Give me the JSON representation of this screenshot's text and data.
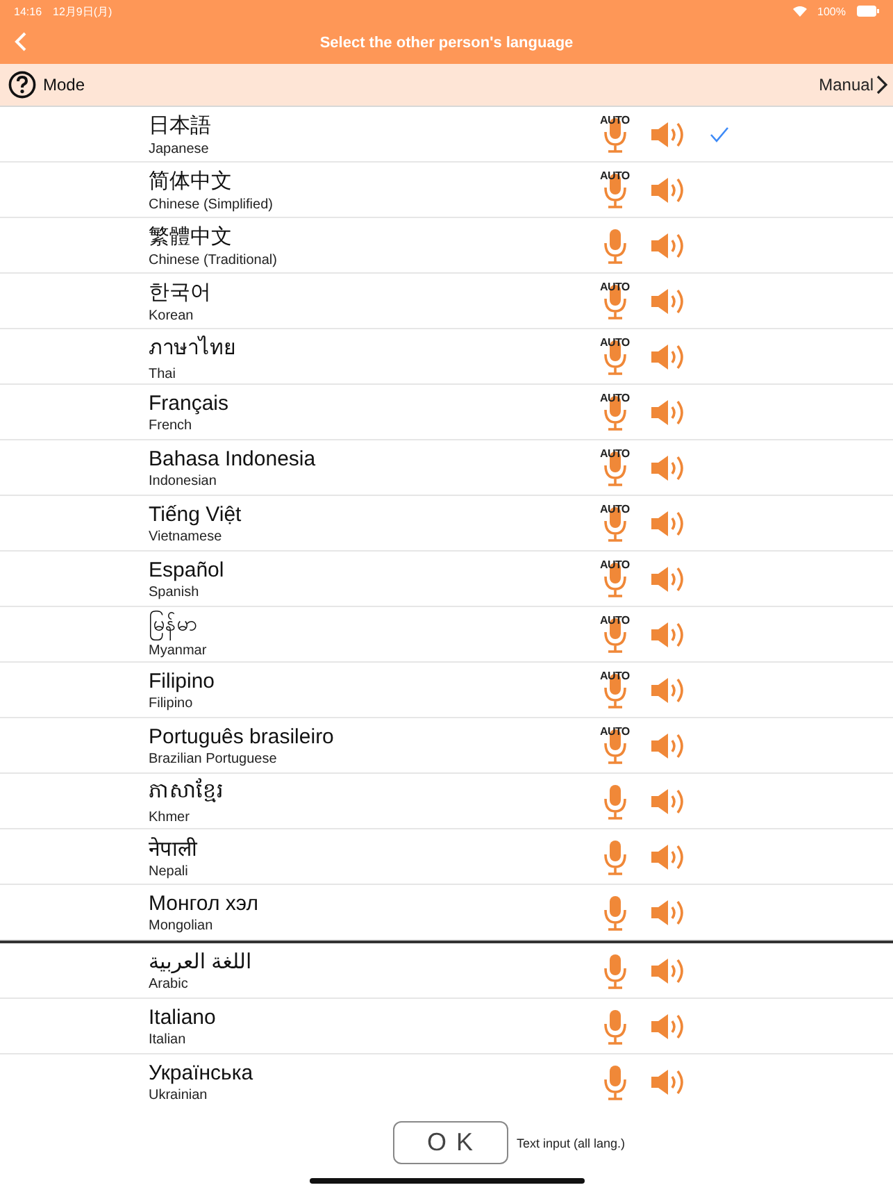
{
  "status_bar": {
    "time": "14:16",
    "date": "12月9日(月)",
    "battery": "100%"
  },
  "nav": {
    "title": "Select the other person's language"
  },
  "mode_bar": {
    "label": "Mode",
    "value": "Manual"
  },
  "sections": [
    {
      "languages": [
        {
          "native": "日本語",
          "english": "Japanese",
          "badge": "AUTO",
          "selected": true
        },
        {
          "native": "简体中文",
          "english": "Chinese (Simplified)",
          "badge": "AUTO",
          "selected": false
        },
        {
          "native": "繁體中文",
          "english": "Chinese (Traditional)",
          "selected": false
        },
        {
          "native": "한국어",
          "english": "Korean",
          "badge": "AUTO",
          "selected": false
        },
        {
          "native": "ภาษาไทย",
          "english": "Thai",
          "badge": "AUTO",
          "selected": false
        },
        {
          "native": "Français",
          "english": "French",
          "badge": "AUTO",
          "selected": false
        },
        {
          "native": "Bahasa Indonesia",
          "english": "Indonesian",
          "badge": "AUTO",
          "selected": false
        },
        {
          "native": "Tiếng Việt",
          "english": "Vietnamese",
          "badge": "AUTO",
          "selected": false
        },
        {
          "native": "Español",
          "english": "Spanish",
          "badge": "AUTO",
          "selected": false
        },
        {
          "native": "မြန်မာ",
          "english": "Myanmar",
          "badge": "AUTO",
          "selected": false
        },
        {
          "native": "Filipino",
          "english": "Filipino",
          "badge": "AUTO",
          "selected": false
        },
        {
          "native": "Português brasileiro",
          "english": "Brazilian Portuguese",
          "badge": "AUTO",
          "selected": false
        },
        {
          "native": "ភាសាខ្មែរ",
          "english": "Khmer",
          "selected": false
        },
        {
          "native": "नेपाली",
          "english": "Nepali",
          "selected": false
        },
        {
          "native": "Монгол хэл",
          "english": "Mongolian",
          "selected": false
        }
      ]
    },
    {
      "languages": [
        {
          "native": "اللغة العربية",
          "english": "Arabic",
          "selected": false
        },
        {
          "native": "Italiano",
          "english": "Italian",
          "selected": false
        },
        {
          "native": "Українська",
          "english": "Ukrainian",
          "selected": false
        }
      ]
    }
  ],
  "footer": {
    "ok": "O K",
    "note": "Text input (all lang.)"
  }
}
